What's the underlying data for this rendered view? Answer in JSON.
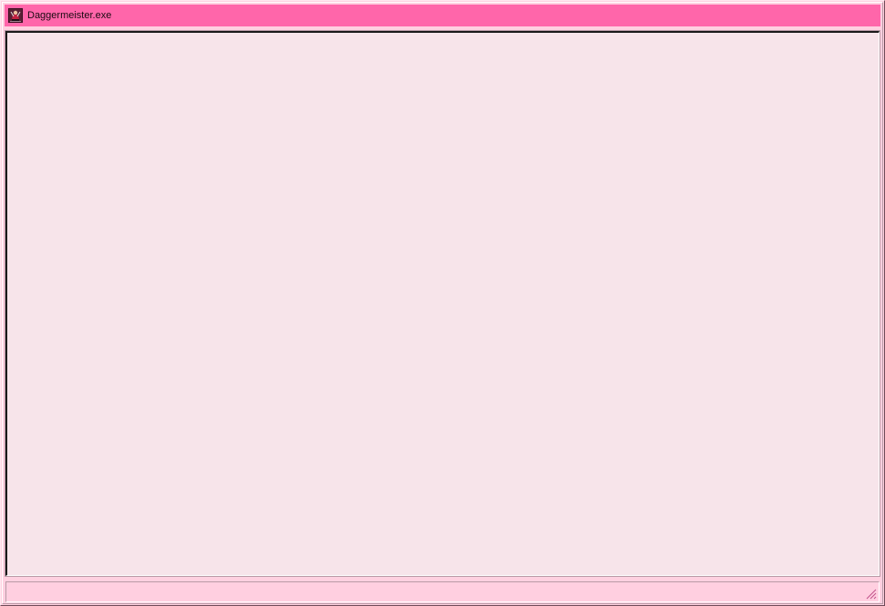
{
  "window": {
    "title": "Daggermeister.exe",
    "icon": "daggermeister-app-icon"
  },
  "colors": {
    "titlebar": "#ff66aa",
    "window_frame": "#ffd0e0",
    "client_area": "#f7e4ea",
    "status_bar": "#ffcfe0",
    "grip": "#c0508a"
  },
  "status_bar": {
    "text": ""
  }
}
